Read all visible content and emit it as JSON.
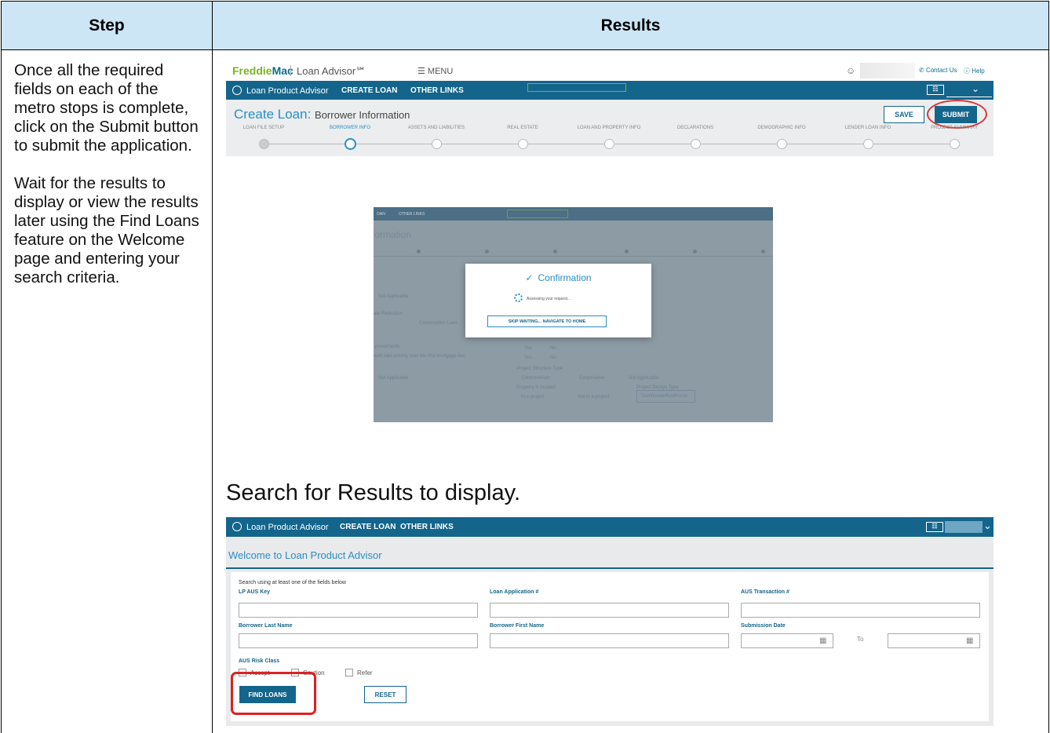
{
  "table": {
    "header_step": "Step",
    "header_results": "Results",
    "step_para1": "Once all the required fields on each of the metro stops is complete, click on the Submit button to submit the application.",
    "step_para2": "Wait for the results to display or view the results later using the Find Loans feature on the Welcome page and entering your search criteria.",
    "caption": "Search for Results to display."
  },
  "shot1": {
    "logo_freddie": "Freddie",
    "logo_mac": "Mac",
    "product": "Loan Advisor℠",
    "menu": "☰ MENU",
    "contact": "Contact Us",
    "help": "Help",
    "nav_lpa": "Loan Product Advisor",
    "nav_create": "CREATE LOAN",
    "nav_other": "OTHER LINKS",
    "page_title": "Create Loan:",
    "page_subtitle": "Borrower Information",
    "save": "SAVE",
    "submit": "SUBMIT",
    "steps": [
      {
        "label": "LOAN FILE SETUP",
        "state": "done"
      },
      {
        "label": "BORROWER INFO",
        "state": "active"
      },
      {
        "label": "ASSETS AND LIABILITIES",
        "state": "todo"
      },
      {
        "label": "REAL ESTATE",
        "state": "todo"
      },
      {
        "label": "LOAN AND PROPERTY INFO",
        "state": "todo"
      },
      {
        "label": "DECLARATIONS",
        "state": "todo"
      },
      {
        "label": "DEMOGRAPHIC INFO",
        "state": "todo"
      },
      {
        "label": "LENDER LOAN INFO",
        "state": "todo"
      },
      {
        "label": "PROJECT SUMMARY",
        "state": "todo"
      }
    ],
    "accent": "#14658c",
    "highlight": "#d63a3a"
  },
  "shot2": {
    "nav_a": "OAN",
    "nav_b": "OTHER LINKS",
    "bg_title": "formation",
    "bg_na1": "Not Applicable",
    "bg_reduction": "ate Reduction",
    "bg_construction": "Construction Loan",
    "bg_improvements": "provements",
    "bg_priority": "ould take priority over the first mortgage lien",
    "bg_na2": "Not Applicable",
    "bg_yes": "Yes",
    "bg_no": "No",
    "bg_project_type": "Project Structure Type",
    "bg_condo": "Condominium",
    "bg_coop": "Cooperative",
    "bg_na3": "Not Applicable",
    "bg_located": "Property is located",
    "bg_in_project": "In a project",
    "bg_not_in": "Not in a project",
    "bg_design": "Project Design Type",
    "bg_design_val": "Townhouse/Rowhouse",
    "modal_title": "Confirmation",
    "modal_msg": "Assessing your request...",
    "modal_btn": "SKIP WAITING... NAVIGATE TO HOME"
  },
  "shot3": {
    "nav_lpa": "Loan Product Advisor",
    "nav_create": "CREATE LOAN",
    "nav_other": "OTHER LINKS",
    "welcome": "Welcome to Loan Product Advisor",
    "hint": "Search using at least one of the fields below",
    "lbl_lp_key": "LP AUS Key",
    "lbl_loan_app": "Loan Application #",
    "lbl_aus_tx": "AUS Transaction #",
    "lbl_last": "Borrower Last Name",
    "lbl_first": "Borrower First Name",
    "lbl_sub_date": "Submission Date",
    "lbl_to": "To",
    "lbl_risk": "AUS Risk Class",
    "cb_accept": "Accept",
    "cb_caution": "Caution",
    "cb_refer": "Refer",
    "find": "FIND LOANS",
    "reset": "RESET"
  }
}
